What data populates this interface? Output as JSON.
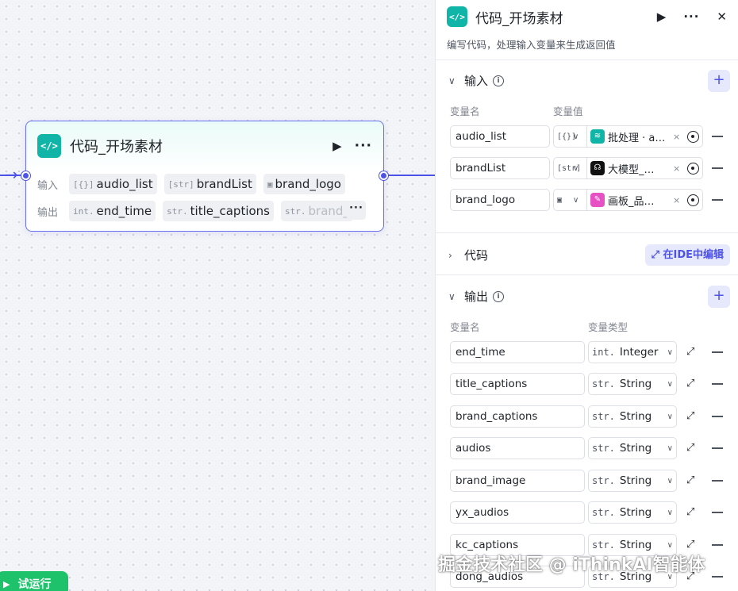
{
  "node": {
    "title": "代码_开场素材",
    "badge": "</>",
    "run_icon": "▶",
    "more_icon": "···",
    "input_label": "输入",
    "output_label": "输出",
    "inputs": [
      {
        "type_tag": "[{}]",
        "name": "audio_list"
      },
      {
        "type_tag": "[str]",
        "name": "brandList"
      },
      {
        "type_tag": "▣",
        "name": "brand_logo"
      }
    ],
    "outputs": [
      {
        "type_tag": "int.",
        "name": "end_time"
      },
      {
        "type_tag": "str.",
        "name": "title_captions"
      },
      {
        "type_tag": "str.",
        "name": "brand_"
      }
    ],
    "output_more": "···"
  },
  "try_run": {
    "icon": "▶",
    "label": "试运行"
  },
  "panel": {
    "title": "代码_开场素材",
    "badge": "</>",
    "run_icon": "▶",
    "more_icon": "···",
    "close_icon": "✕",
    "description": "编写代码，处理输入变量来生成返回值",
    "input_section": {
      "title": "输入",
      "chevron": "∨",
      "info": "i",
      "add": "+",
      "col_name": "变量名",
      "col_value": "变量值",
      "rows": [
        {
          "name": "audio_list",
          "type_tag": "[{}]",
          "ref_text": "批处理 · au…",
          "ref_icon": "≋",
          "ref_color": "#11b5a7",
          "removable": "×"
        },
        {
          "name": "brandList",
          "type_tag": "[str]",
          "ref_text": "大模型_…",
          "ref_icon": "☊",
          "ref_color": "#111111",
          "removable": "×"
        },
        {
          "name": "brand_logo",
          "type_tag": "▣",
          "ref_text": "画板_品…",
          "ref_icon": "✎",
          "ref_color": "#e651c3",
          "removable": "×"
        }
      ]
    },
    "code_section": {
      "title": "代码",
      "chevron": "›",
      "ide_icon": "⤢",
      "ide_label": "在IDE中编辑"
    },
    "output_section": {
      "title": "输出",
      "chevron": "∨",
      "info": "i",
      "add": "+",
      "col_name": "变量名",
      "col_type": "变量类型",
      "rows": [
        {
          "name": "end_time",
          "type_tag": "int.",
          "type": "Integer"
        },
        {
          "name": "title_captions",
          "type_tag": "str.",
          "type": "String"
        },
        {
          "name": "brand_captions",
          "type_tag": "str.",
          "type": "String"
        },
        {
          "name": "audios",
          "type_tag": "str.",
          "type": "String"
        },
        {
          "name": "brand_image",
          "type_tag": "str.",
          "type": "String"
        },
        {
          "name": "yx_audios",
          "type_tag": "str.",
          "type": "String"
        },
        {
          "name": "kc_captions",
          "type_tag": "str.",
          "type": "String"
        },
        {
          "name": "dong_audios",
          "type_tag": "str.",
          "type": "String"
        }
      ]
    }
  },
  "watermark": "掘金技术社区 @ iThinkAI智能体",
  "colors": {
    "accent": "#4d53e8",
    "code_teal": "#11b5a7",
    "run_green": "#1ec26a"
  }
}
